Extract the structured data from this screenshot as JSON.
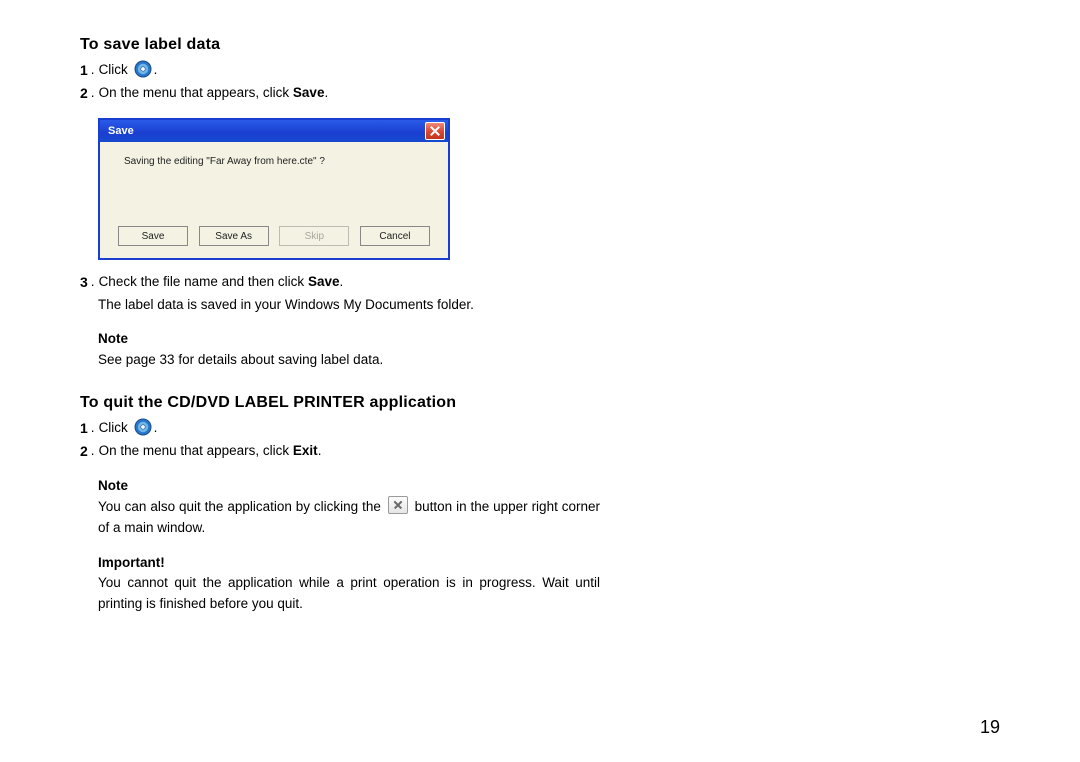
{
  "section1": {
    "heading": "To save label data",
    "step1_num": "1",
    "step1_text": "Click ",
    "step1_after": ".",
    "step2_num": "2",
    "step2_text_a": "On the menu that appears, click ",
    "step2_bold": "Save",
    "step2_text_b": ".",
    "step3_num": "3",
    "step3_text_a": "Check the file name and then click ",
    "step3_bold": "Save",
    "step3_text_b": ".",
    "step3_sub": "The label data is saved in your Windows My Documents folder.",
    "note_label": "Note",
    "note_text": "See page 33 for details about saving label data."
  },
  "dialog": {
    "title": "Save",
    "message": "Saving the editing \"Far Away from here.cte\" ?",
    "buttons": {
      "save": "Save",
      "save_as": "Save As",
      "skip": "Skip",
      "cancel": "Cancel"
    }
  },
  "section2": {
    "heading": "To quit the CD/DVD LABEL PRINTER application",
    "step1_num": "1",
    "step1_text": "Click ",
    "step1_after": ".",
    "step2_num": "2",
    "step2_text_a": "On the menu that appears, click ",
    "step2_bold": "Exit",
    "step2_text_b": ".",
    "note_label": "Note",
    "note_text_a": "You can also quit the application by clicking the ",
    "note_text_b": " button in the upper right corner of a main window.",
    "important_label": "Important!",
    "important_text": "You cannot quit the application while a print operation is in progress. Wait until printing is finished before you quit."
  },
  "page_number": "19"
}
